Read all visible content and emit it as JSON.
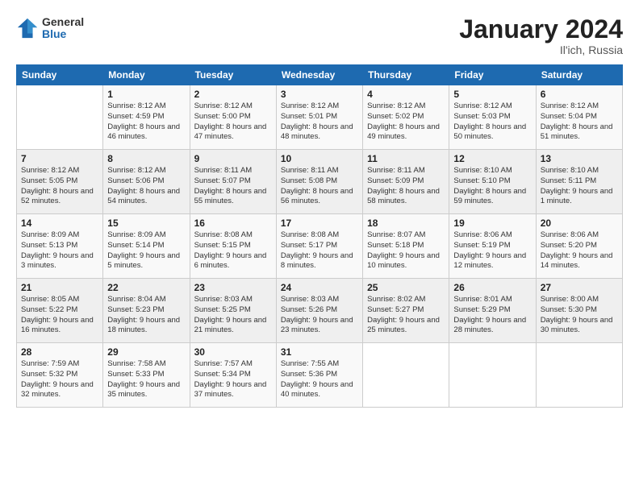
{
  "header": {
    "logo_general": "General",
    "logo_blue": "Blue",
    "title": "January 2024",
    "subtitle": "Il'ich, Russia"
  },
  "calendar": {
    "weekdays": [
      "Sunday",
      "Monday",
      "Tuesday",
      "Wednesday",
      "Thursday",
      "Friday",
      "Saturday"
    ],
    "weeks": [
      [
        {
          "day": null
        },
        {
          "day": "1",
          "sunrise": "8:12 AM",
          "sunset": "4:59 PM",
          "daylight": "8 hours and 46 minutes."
        },
        {
          "day": "2",
          "sunrise": "8:12 AM",
          "sunset": "5:00 PM",
          "daylight": "8 hours and 47 minutes."
        },
        {
          "day": "3",
          "sunrise": "8:12 AM",
          "sunset": "5:01 PM",
          "daylight": "8 hours and 48 minutes."
        },
        {
          "day": "4",
          "sunrise": "8:12 AM",
          "sunset": "5:02 PM",
          "daylight": "8 hours and 49 minutes."
        },
        {
          "day": "5",
          "sunrise": "8:12 AM",
          "sunset": "5:03 PM",
          "daylight": "8 hours and 50 minutes."
        },
        {
          "day": "6",
          "sunrise": "8:12 AM",
          "sunset": "5:04 PM",
          "daylight": "8 hours and 51 minutes."
        }
      ],
      [
        {
          "day": "7",
          "sunrise": "8:12 AM",
          "sunset": "5:05 PM",
          "daylight": "8 hours and 52 minutes."
        },
        {
          "day": "8",
          "sunrise": "8:12 AM",
          "sunset": "5:06 PM",
          "daylight": "8 hours and 54 minutes."
        },
        {
          "day": "9",
          "sunrise": "8:11 AM",
          "sunset": "5:07 PM",
          "daylight": "8 hours and 55 minutes."
        },
        {
          "day": "10",
          "sunrise": "8:11 AM",
          "sunset": "5:08 PM",
          "daylight": "8 hours and 56 minutes."
        },
        {
          "day": "11",
          "sunrise": "8:11 AM",
          "sunset": "5:09 PM",
          "daylight": "8 hours and 58 minutes."
        },
        {
          "day": "12",
          "sunrise": "8:10 AM",
          "sunset": "5:10 PM",
          "daylight": "8 hours and 59 minutes."
        },
        {
          "day": "13",
          "sunrise": "8:10 AM",
          "sunset": "5:11 PM",
          "daylight": "9 hours and 1 minute."
        }
      ],
      [
        {
          "day": "14",
          "sunrise": "8:09 AM",
          "sunset": "5:13 PM",
          "daylight": "9 hours and 3 minutes."
        },
        {
          "day": "15",
          "sunrise": "8:09 AM",
          "sunset": "5:14 PM",
          "daylight": "9 hours and 5 minutes."
        },
        {
          "day": "16",
          "sunrise": "8:08 AM",
          "sunset": "5:15 PM",
          "daylight": "9 hours and 6 minutes."
        },
        {
          "day": "17",
          "sunrise": "8:08 AM",
          "sunset": "5:17 PM",
          "daylight": "9 hours and 8 minutes."
        },
        {
          "day": "18",
          "sunrise": "8:07 AM",
          "sunset": "5:18 PM",
          "daylight": "9 hours and 10 minutes."
        },
        {
          "day": "19",
          "sunrise": "8:06 AM",
          "sunset": "5:19 PM",
          "daylight": "9 hours and 12 minutes."
        },
        {
          "day": "20",
          "sunrise": "8:06 AM",
          "sunset": "5:20 PM",
          "daylight": "9 hours and 14 minutes."
        }
      ],
      [
        {
          "day": "21",
          "sunrise": "8:05 AM",
          "sunset": "5:22 PM",
          "daylight": "9 hours and 16 minutes."
        },
        {
          "day": "22",
          "sunrise": "8:04 AM",
          "sunset": "5:23 PM",
          "daylight": "9 hours and 18 minutes."
        },
        {
          "day": "23",
          "sunrise": "8:03 AM",
          "sunset": "5:25 PM",
          "daylight": "9 hours and 21 minutes."
        },
        {
          "day": "24",
          "sunrise": "8:03 AM",
          "sunset": "5:26 PM",
          "daylight": "9 hours and 23 minutes."
        },
        {
          "day": "25",
          "sunrise": "8:02 AM",
          "sunset": "5:27 PM",
          "daylight": "9 hours and 25 minutes."
        },
        {
          "day": "26",
          "sunrise": "8:01 AM",
          "sunset": "5:29 PM",
          "daylight": "9 hours and 28 minutes."
        },
        {
          "day": "27",
          "sunrise": "8:00 AM",
          "sunset": "5:30 PM",
          "daylight": "9 hours and 30 minutes."
        }
      ],
      [
        {
          "day": "28",
          "sunrise": "7:59 AM",
          "sunset": "5:32 PM",
          "daylight": "9 hours and 32 minutes."
        },
        {
          "day": "29",
          "sunrise": "7:58 AM",
          "sunset": "5:33 PM",
          "daylight": "9 hours and 35 minutes."
        },
        {
          "day": "30",
          "sunrise": "7:57 AM",
          "sunset": "5:34 PM",
          "daylight": "9 hours and 37 minutes."
        },
        {
          "day": "31",
          "sunrise": "7:55 AM",
          "sunset": "5:36 PM",
          "daylight": "9 hours and 40 minutes."
        },
        {
          "day": null
        },
        {
          "day": null
        },
        {
          "day": null
        }
      ]
    ]
  }
}
